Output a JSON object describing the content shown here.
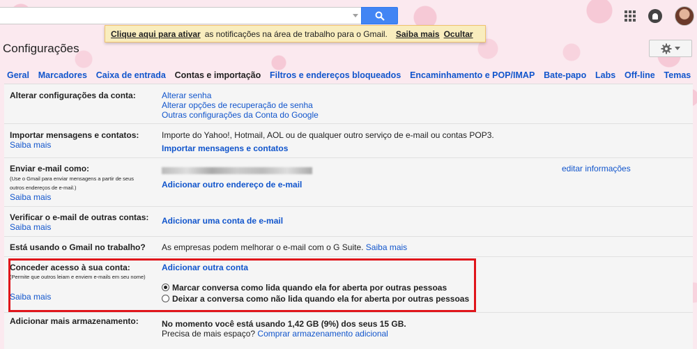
{
  "search": {
    "placeholder": ""
  },
  "notice": {
    "activate_link": "Clique aqui para ativar",
    "message": "as notificações na área de trabalho para o Gmail.",
    "learn_more": "Saiba mais",
    "hide": "Ocultar"
  },
  "page_title": "Configurações",
  "tabs": [
    {
      "label": "Geral"
    },
    {
      "label": "Marcadores"
    },
    {
      "label": "Caixa de entrada"
    },
    {
      "label": "Contas e importação",
      "active": true
    },
    {
      "label": "Filtros e endereços bloqueados"
    },
    {
      "label": "Encaminhamento e POP/IMAP"
    },
    {
      "label": "Bate-papo"
    },
    {
      "label": "Labs"
    },
    {
      "label": "Off-line"
    },
    {
      "label": "Temas"
    }
  ],
  "sections": {
    "account": {
      "label": "Alterar configurações da conta:",
      "links": [
        "Alterar senha",
        "Alterar opções de recuperação de senha",
        "Outras configurações da Conta do Google"
      ]
    },
    "import": {
      "label": "Importar mensagens e contatos:",
      "learn_more": "Saiba mais",
      "text": "Importe do Yahoo!, Hotmail, AOL ou de qualquer outro serviço de e-mail ou contas POP3.",
      "action": "Importar mensagens e contatos"
    },
    "send_as": {
      "label": "Enviar e-mail como:",
      "note": "(Use o Gmail para enviar mensagens a partir de seus outros endereços de e-mail.)",
      "learn_more": "Saiba mais",
      "edit": "editar informações",
      "action": "Adicionar outro endereço de e-mail"
    },
    "check_mail": {
      "label": "Verificar o e-mail de outras contas:",
      "learn_more": "Saiba mais",
      "action": "Adicionar uma conta de e-mail"
    },
    "work": {
      "label": "Está usando o Gmail no trabalho?",
      "text": "As empresas podem melhorar o e-mail com o G Suite.",
      "learn_more": "Saiba mais"
    },
    "grant": {
      "label": "Conceder acesso à sua conta:",
      "note": "(Permite que outros leiam e enviem e-mails em seu nome)",
      "learn_more": "Saiba mais",
      "action": "Adicionar outra conta",
      "option1": "Marcar conversa como lida quando ela for aberta por outras pessoas",
      "option2": "Deixar a conversa como não lida quando ela for aberta por outras pessoas",
      "selected": 1
    },
    "storage": {
      "label": "Adicionar mais armazenamento:",
      "usage": "No momento você está usando 1,42 GB (9%) dos seus 15 GB.",
      "question": "Precisa de mais espaço?",
      "action": "Comprar armazenamento adicional"
    }
  },
  "colors": {
    "link": "#1155cc",
    "search_button": "#4285f4",
    "highlight": "#e0151b",
    "notice_bg": "#f9edbe"
  }
}
